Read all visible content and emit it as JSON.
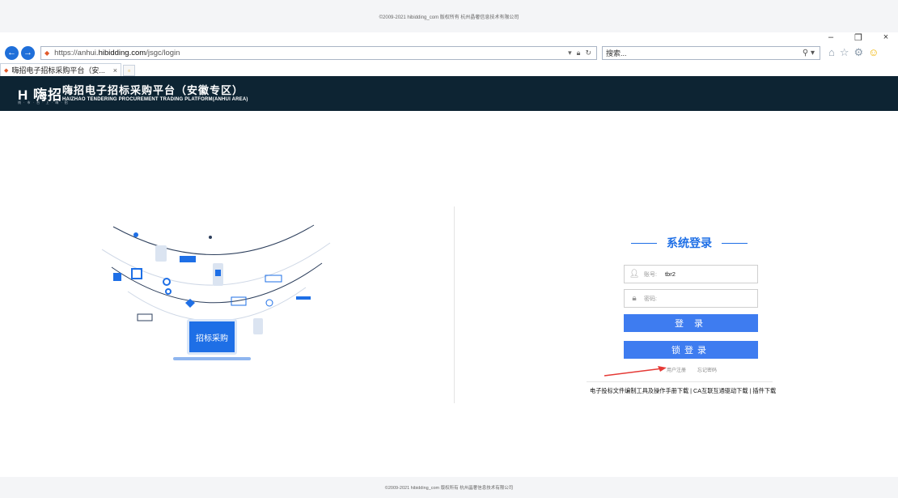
{
  "copyright_top": "©2009-2021 hibidding_com 版权所有 杭州晶奢信息技术有限公司",
  "browser": {
    "url_prefix": "https://anhui.",
    "url_domain": "hibidding.com",
    "url_path": "/jsgc/login",
    "search_placeholder": "搜索...",
    "tab_title": "嗨招电子招标采购平台（安...",
    "tab_close": "×"
  },
  "header": {
    "logo_text": "H 嗨招",
    "logo_sub": "线 · 市 · 台 · 上 · 嗨 · 招",
    "title_cn": "嗨招电子招标采购平台（安徽专区）",
    "title_en": "HAIZHAO TENDERING PROCUREMENT TRADING PLATFORM(ANHUI AREA)"
  },
  "illustration": {
    "laptop_label": "招标采购"
  },
  "login": {
    "title": "系统登录",
    "account_label": "账号:",
    "account_value": "tbr2",
    "password_label": "密码:",
    "login_button": "登 录",
    "lock_login_button": "锁登录",
    "register_link": "用户注册",
    "forgot_link": "忘记密码"
  },
  "downloads": {
    "text": "电子投标文件编制工具及操作手册下载 | CA互联互通驱动下载 | 插件下载"
  },
  "copyright_bottom": "©2009-2021 hibidding_com 版权所有 杭州晶奢信息技术有限公司",
  "colors": {
    "header_bg": "#0d2433",
    "accent": "#1e6fe6",
    "button": "#3e7cf0",
    "arrow": "#e53935"
  }
}
